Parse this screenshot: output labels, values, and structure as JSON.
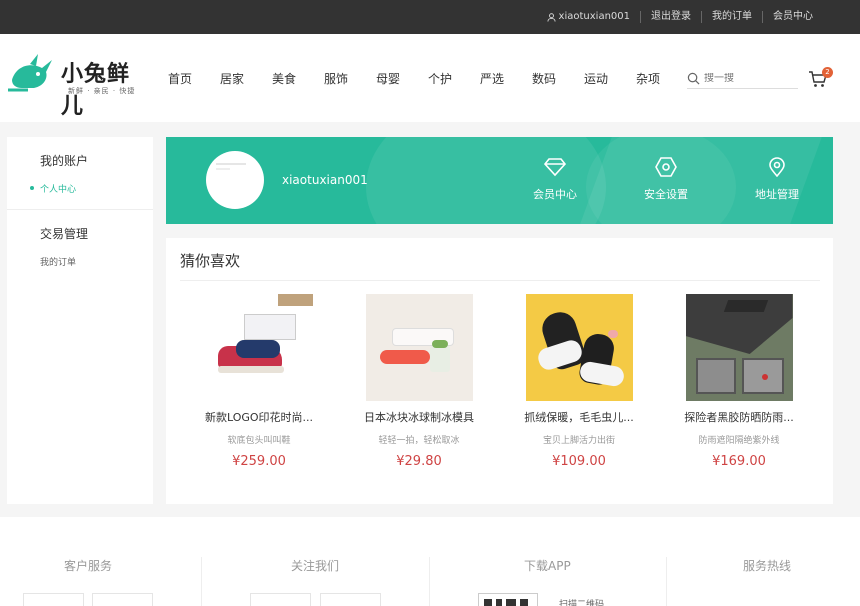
{
  "topbar": {
    "username": "xiaotuxian001",
    "logout": "退出登录",
    "my_orders": "我的订单",
    "member_center": "会员中心"
  },
  "header": {
    "logo_text": "小兔鲜儿",
    "logo_sub": "新鲜 · 亲民 · 快捷",
    "nav": [
      "首页",
      "居家",
      "美食",
      "服饰",
      "母婴",
      "个护",
      "严选",
      "数码",
      "运动",
      "杂项"
    ],
    "search_placeholder": "搜一搜",
    "cart_count": "2"
  },
  "sidebar": {
    "account_title": "我的账户",
    "account_links": [
      "个人中心"
    ],
    "trade_title": "交易管理",
    "trade_links": [
      "我的订单"
    ]
  },
  "banner": {
    "username": "xiaotuxian001",
    "items": [
      "会员中心",
      "安全设置",
      "地址管理"
    ],
    "accent_color": "#27ba9b"
  },
  "guess": {
    "title": "猜你喜欢",
    "products": [
      {
        "name": "新款LOGO印花时尚...",
        "desc": "软底包头叫叫鞋",
        "price": "¥259.00"
      },
      {
        "name": "日本冰块冰球制冰模具",
        "desc": "轻轻一拍，轻松取冰",
        "price": "¥29.80"
      },
      {
        "name": "抓绒保暖，毛毛虫儿...",
        "desc": "宝贝上脚活力出街",
        "price": "¥109.00"
      },
      {
        "name": "探险者黑胶防晒防雨...",
        "desc": "防雨遮阳隔绝紫外线",
        "price": "¥169.00"
      }
    ]
  },
  "footer": {
    "columns": [
      "客户服务",
      "关注我们",
      "下载APP",
      "服务热线"
    ],
    "qr_label": "扫描二维码"
  }
}
